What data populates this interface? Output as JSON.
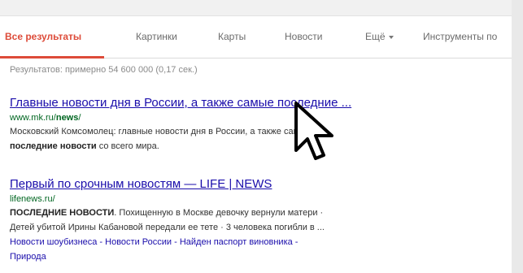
{
  "tabs": [
    {
      "label": "Все результаты",
      "active": true
    },
    {
      "label": "Картинки",
      "active": false
    },
    {
      "label": "Карты",
      "active": false
    },
    {
      "label": "Новости",
      "active": false
    },
    {
      "label": "Ещё",
      "active": false
    },
    {
      "label": "Инструменты по",
      "active": false
    }
  ],
  "stats": "Результатов: примерно 54 600 000 (0,17 сек.)",
  "results": [
    {
      "title": "Главные новости дня в России, а также самые последние ...",
      "url_prefix": "www.mk.ru/",
      "url_bold": "news",
      "url_suffix": "/",
      "snippet_line1": "Московский Комсомолец: главные новости дня в России, а также самые",
      "snippet_line2_bold": "последние новости",
      "snippet_line2_rest": " со всего мира."
    },
    {
      "title": "Первый по срочным новостям — LIFE | NEWS",
      "url_prefix": "lifenews.ru/",
      "snippet_bold": "ПОСЛЕДНИЕ НОВОСТИ",
      "snippet_line1_rest": ". Похищенную в Москве девочку вернули матери ·",
      "snippet_line2": "Детей убитой Ирины Кабановой передали ее тете · 3 человека погибли в ...",
      "sitelinks_line1": "Новости шоубизнеса - Новости России - Найден паспорт виновника -",
      "sitelinks_line2": "Природа"
    }
  ],
  "colors": {
    "accent": "#dd4b39",
    "link": "#1a0dab",
    "url": "#006621"
  },
  "icons": {
    "more_caret": "chevron-down-icon",
    "cursor": "mouse-pointer-icon"
  }
}
